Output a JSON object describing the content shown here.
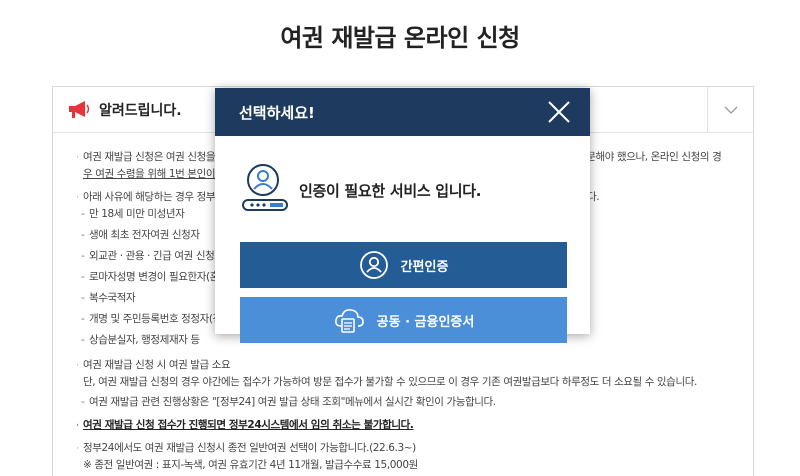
{
  "page": {
    "title": "여권 재발급 온라인 신청"
  },
  "notice": {
    "title": "알려드립니다.",
    "lines": [
      "여권 재발급 신청은 여권 신청을 온",
      "우 여권 수령을 위해 1번 본인이 직",
      "아래 사유에 해당하는 경우 정부24",
      "만 18세 미만 미성년자",
      "생애 최초 전자여권 신청자",
      "외교관 · 관용 · 긴급 여권 신청자",
      "로마자성명 변경이 필요한자(혼",
      "복수국적자",
      "개명 및 주민등록번호 정정자(정",
      "상습분실자, 행정제재자 등",
      "여권 재발급 신청 시 여권 발급 소요",
      "단, 여권 재발급 신청의 경우 야간에는 접수가 가능하여 방문 접수가 불가할 수 있으므로 이 경우 기존 여권발급보다 하루정도 더 소요될 수 있습니다.",
      "여권 재발급 관련 진행상황은 \"[정부24] 여권 발급 상태 조회\"메뉴에서 실시간 확인이 가능합니다.",
      "여권 재발급 신청 접수가 진행되면 정부24시스템에서 임의 취소는 불가합니다.",
      "정부24에서도 여권 재발급 신청시 종전 일반여권 선택이 가능합니다.(22.6.3~)",
      "※ 종전 일반여권 : 표지-녹색, 여권 유효기간 4년 11개월, 발급수수료 15,000원"
    ],
    "right_fragments": {
      "line0": "방문해야 했으나, 온라인 신청의 경",
      "line2": "다."
    }
  },
  "modal": {
    "title": "선택하세요!",
    "message": "인증이 필요한 서비스 입니다.",
    "buttons": {
      "simple_auth": "간편인증",
      "joint_cert": "공동 · 금융인증서"
    }
  },
  "colors": {
    "modal_header": "#1e3a5f",
    "btn_simple": "#245c96",
    "btn_cert": "#4b8fd9",
    "icon_navy": "#1e3a5f"
  }
}
